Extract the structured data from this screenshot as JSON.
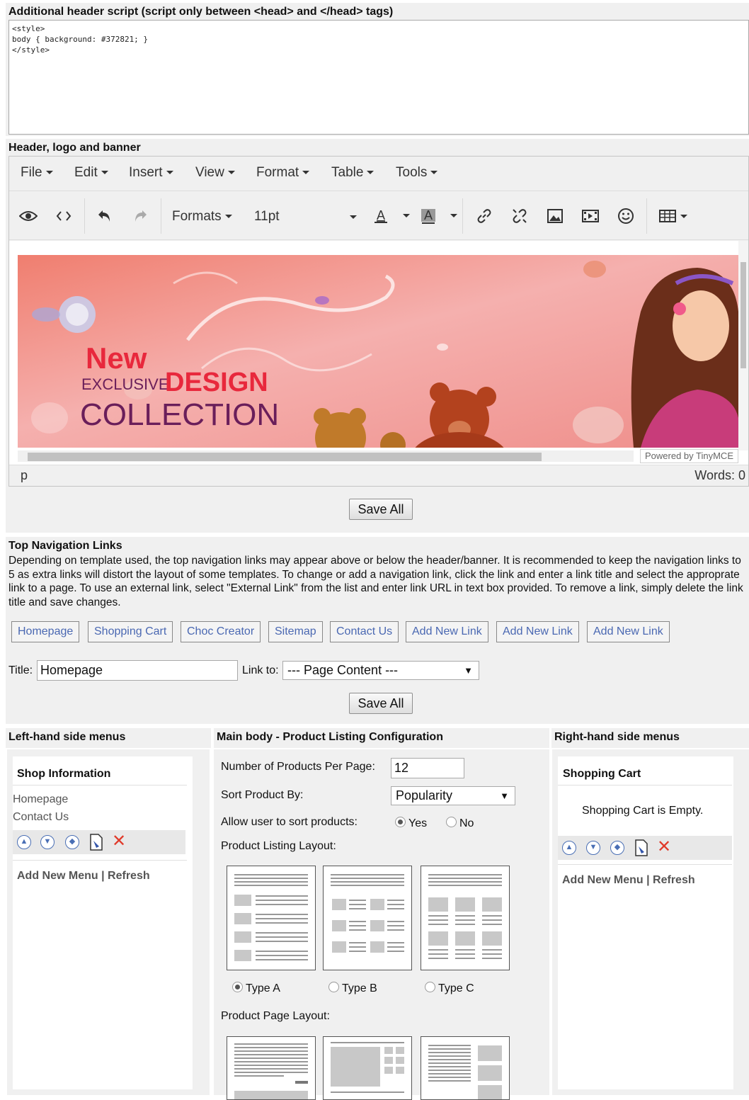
{
  "header_script": {
    "label": "Additional header script (script only between <head> and </head> tags)",
    "content": "<style>\nbody { background: #372821; }\n</style>"
  },
  "banner_section": {
    "label": "Header, logo and banner",
    "menubar": [
      "File",
      "Edit",
      "Insert",
      "View",
      "Format",
      "Table",
      "Tools"
    ],
    "toolbar": {
      "formats_label": "Formats",
      "font_size": "11pt",
      "icons": [
        "preview-icon",
        "source-code-icon",
        "undo-icon",
        "redo-icon",
        "font-color-icon",
        "background-color-icon",
        "link-icon",
        "unlink-icon",
        "image-icon",
        "media-icon",
        "emoticon-icon",
        "table-icon"
      ]
    },
    "banner_text": {
      "line1": "New",
      "line2a": "EXCLUSIVE",
      "line2b": "DESIGN",
      "line3": "COLLECTION"
    },
    "powered_by": "Powered by TinyMCE",
    "status_path": "p",
    "word_count": "Words: 0",
    "save_label": "Save All"
  },
  "top_nav": {
    "title": "Top Navigation Links",
    "description": "Depending on template used, the top navigation links may appear above or below the header/banner. It is recommended to keep the navigation links to 5 as extra links will distort the layout of some templates. To change or add a navigation link, click the link and enter a link title and select the approprate link to a page. To use an external link, select \"External Link\" from the list and enter link URL in text box provided. To remove a link, simply delete the link title and save changes.",
    "links": [
      "Homepage",
      "Shopping Cart",
      "Choc Creator",
      "Sitemap",
      "Contact Us",
      "Add New Link",
      "Add New Link",
      "Add New Link"
    ],
    "title_label": "Title:",
    "title_value": "Homepage",
    "link_to_label": "Link to:",
    "link_to_value": "--- Page Content ---",
    "save_label": "Save All"
  },
  "left_menus": {
    "header": "Left-hand side menus",
    "card_title": "Shop Information",
    "items": [
      "Homepage",
      "Contact Us"
    ],
    "footer": "Add New Menu | Refresh"
  },
  "main_body": {
    "header": "Main body - Product Listing Configuration",
    "per_page_label": "Number of Products Per Page:",
    "per_page_value": "12",
    "sort_label": "Sort Product By:",
    "sort_value": "Popularity",
    "allow_sort_label": "Allow user to sort products:",
    "allow_sort_yes": "Yes",
    "allow_sort_no": "No",
    "allow_sort_selected": "Yes",
    "listing_layout_label": "Product Listing Layout:",
    "listing_types": [
      "Type A",
      "Type B",
      "Type C"
    ],
    "listing_selected": "Type A",
    "page_layout_label": "Product Page Layout:"
  },
  "right_menus": {
    "header": "Right-hand side menus",
    "card_title": "Shopping Cart",
    "cart_message": "Shopping Cart is Empty.",
    "footer": "Add New Menu | Refresh"
  },
  "colors": {
    "link_blue": "#4a68b2",
    "delete_red": "#e03a2a",
    "banner_pink": "#f2a0a0",
    "banner_red_text": "#e8283c",
    "banner_purple_text": "#6a1e5a"
  }
}
